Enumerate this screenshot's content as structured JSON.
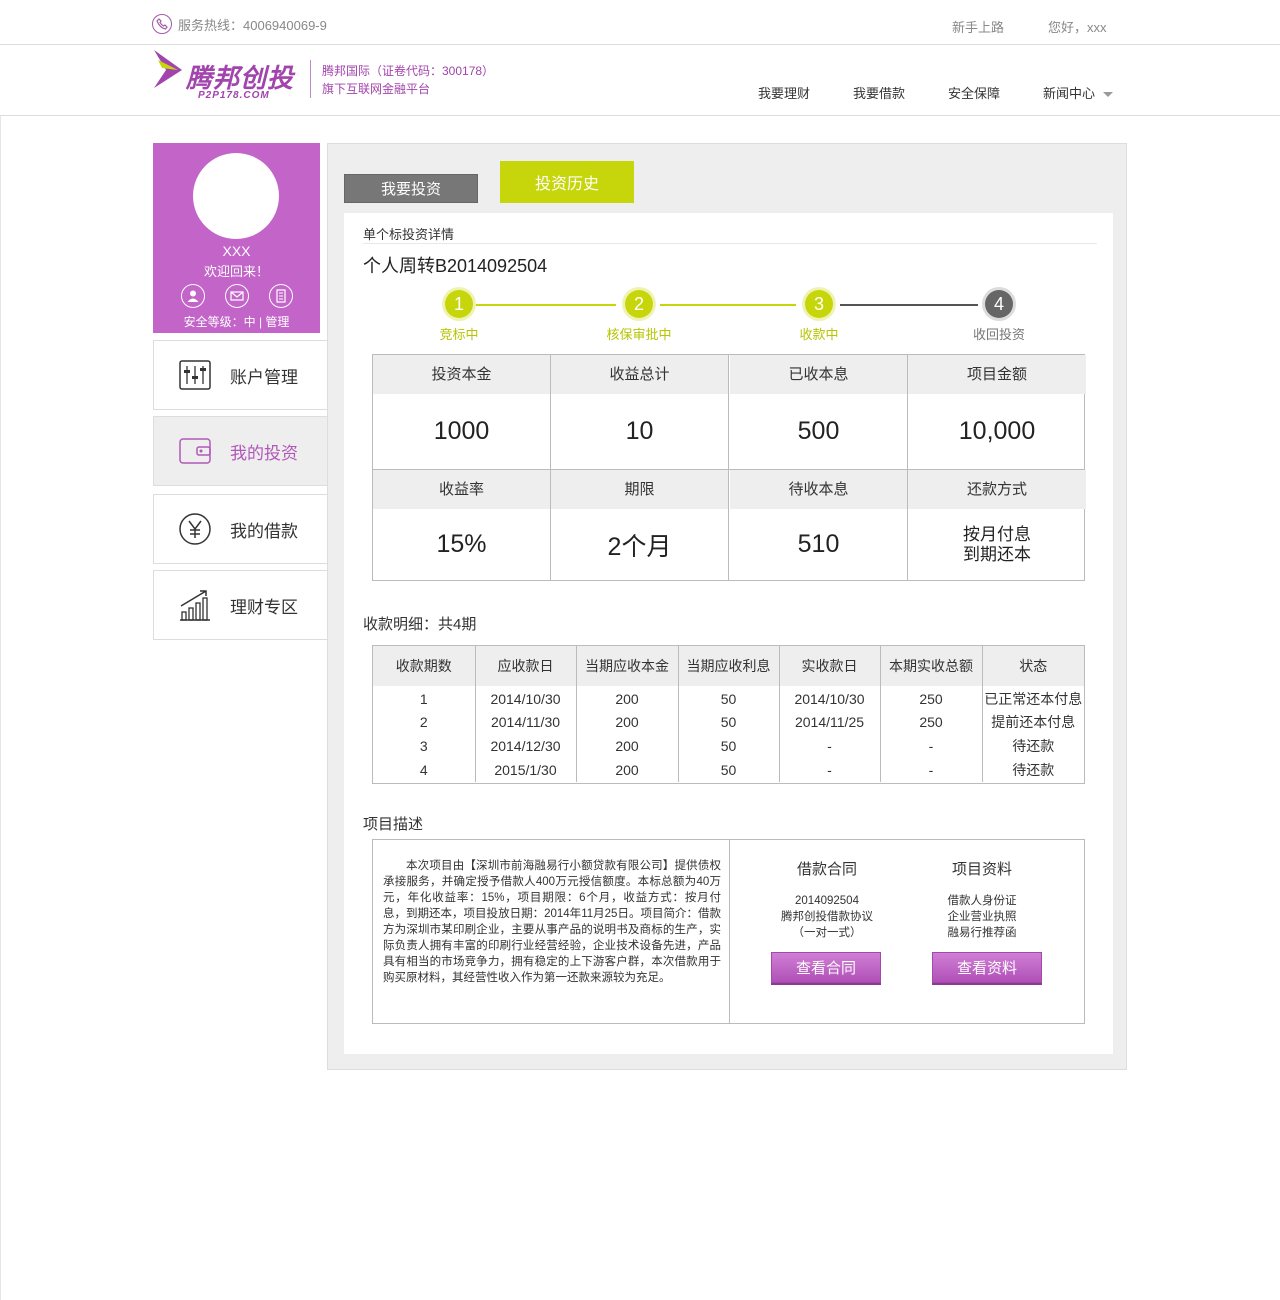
{
  "topbar": {
    "hotline": "服务热线：4006940069-9",
    "newbie": "新手上路",
    "greeting": "您好，xxx"
  },
  "header": {
    "logo_cn": "腾邦创投",
    "logo_en": "P2P178.COM",
    "corp_line1": "腾邦国际（证卷代码：300178）",
    "corp_line2": "旗下互联网金融平台",
    "nav": [
      "我要理财",
      "我要借款",
      "安全保障",
      "新闻中心"
    ]
  },
  "profile": {
    "name": "XXX",
    "welcome": "欢迎回来！",
    "icons": [
      "user-icon",
      "mail-icon",
      "document-icon"
    ],
    "safety_label": "安全等级：中",
    "manage": "管理"
  },
  "sidebar": {
    "items": [
      {
        "label": "账户管理",
        "icon": "account-settings-icon"
      },
      {
        "label": "我的投资",
        "icon": "wallet-icon"
      },
      {
        "label": "我的借款",
        "icon": "yen-icon"
      },
      {
        "label": "理财专区",
        "icon": "bar-chart-icon"
      }
    ]
  },
  "tabs": {
    "invest": "我要投资",
    "history": "投资历史"
  },
  "detail": {
    "section_title": "单个标投资详情",
    "project_name": "个人周转B2014092504"
  },
  "steps": [
    {
      "num": "1",
      "label": "竞标中",
      "active": true
    },
    {
      "num": "2",
      "label": "核保审批中",
      "active": true
    },
    {
      "num": "3",
      "label": "收款中",
      "active": true
    },
    {
      "num": "4",
      "label": "收回投资",
      "active": false
    }
  ],
  "stats": {
    "row1": [
      {
        "label": "投资本金",
        "value": "1000"
      },
      {
        "label": "收益总计",
        "value": "10"
      },
      {
        "label": "已收本息",
        "value": "500"
      },
      {
        "label": "项目金额",
        "value": "10,000"
      }
    ],
    "row2": [
      {
        "label": "收益率",
        "value": "15%"
      },
      {
        "label": "期限",
        "value": "2个月"
      },
      {
        "label": "待收本息",
        "value": "510"
      },
      {
        "label": "还款方式",
        "value_line1": "按月付息",
        "value_line2": "到期还本"
      }
    ]
  },
  "schedule": {
    "title": "收款明细：共4期",
    "headers": [
      "收款期数",
      "应收款日",
      "当期应收本金",
      "当期应收利息",
      "实收款日",
      "本期实收总额",
      "状态"
    ],
    "rows": [
      [
        "1",
        "2014/10/30",
        "200",
        "50",
        "2014/10/30",
        "250",
        "已正常还本付息"
      ],
      [
        "2",
        "2014/11/30",
        "200",
        "50",
        "2014/11/25",
        "250",
        "提前还本付息"
      ],
      [
        "3",
        "2014/12/30",
        "200",
        "50",
        "-",
        "-",
        "待还款"
      ],
      [
        "4",
        "2015/1/30",
        "200",
        "50",
        "-",
        "-",
        "待还款"
      ]
    ]
  },
  "description": {
    "title": "项目描述",
    "text": "本次项目由【深圳市前海融易行小额贷款有限公司】提供债权承接服务，并确定授予借款人400万元授信额度。本标总额为40万元，年化收益率：15%，项目期限：6个月，收益方式：按月付息，到期还本，项目投放日期：2014年11月25日。项目简介：借款方为深圳市某印刷企业，主要从事产品的说明书及商标的生产，实际负责人拥有丰富的印刷行业经营经验，企业技术设备先进，产品具有相当的市场竞争力，拥有稳定的上下游客户群，本次借款用于购买原材料，其经营性收入作为第一还款来源较为充足。",
    "contract": {
      "title": "借款合同",
      "line1": "2014092504",
      "line2": "腾邦创投借款协议",
      "line3": "（一对一式）",
      "button": "查看合同"
    },
    "materials": {
      "title": "项目资料",
      "line1": "借款人身份证",
      "line2": "企业营业执照",
      "line3": "融易行推荐函",
      "button": "查看资料"
    }
  },
  "colors": {
    "brand_purple": "#c264c8",
    "accent_green": "#c7d60a",
    "tab_gray": "#777777"
  }
}
